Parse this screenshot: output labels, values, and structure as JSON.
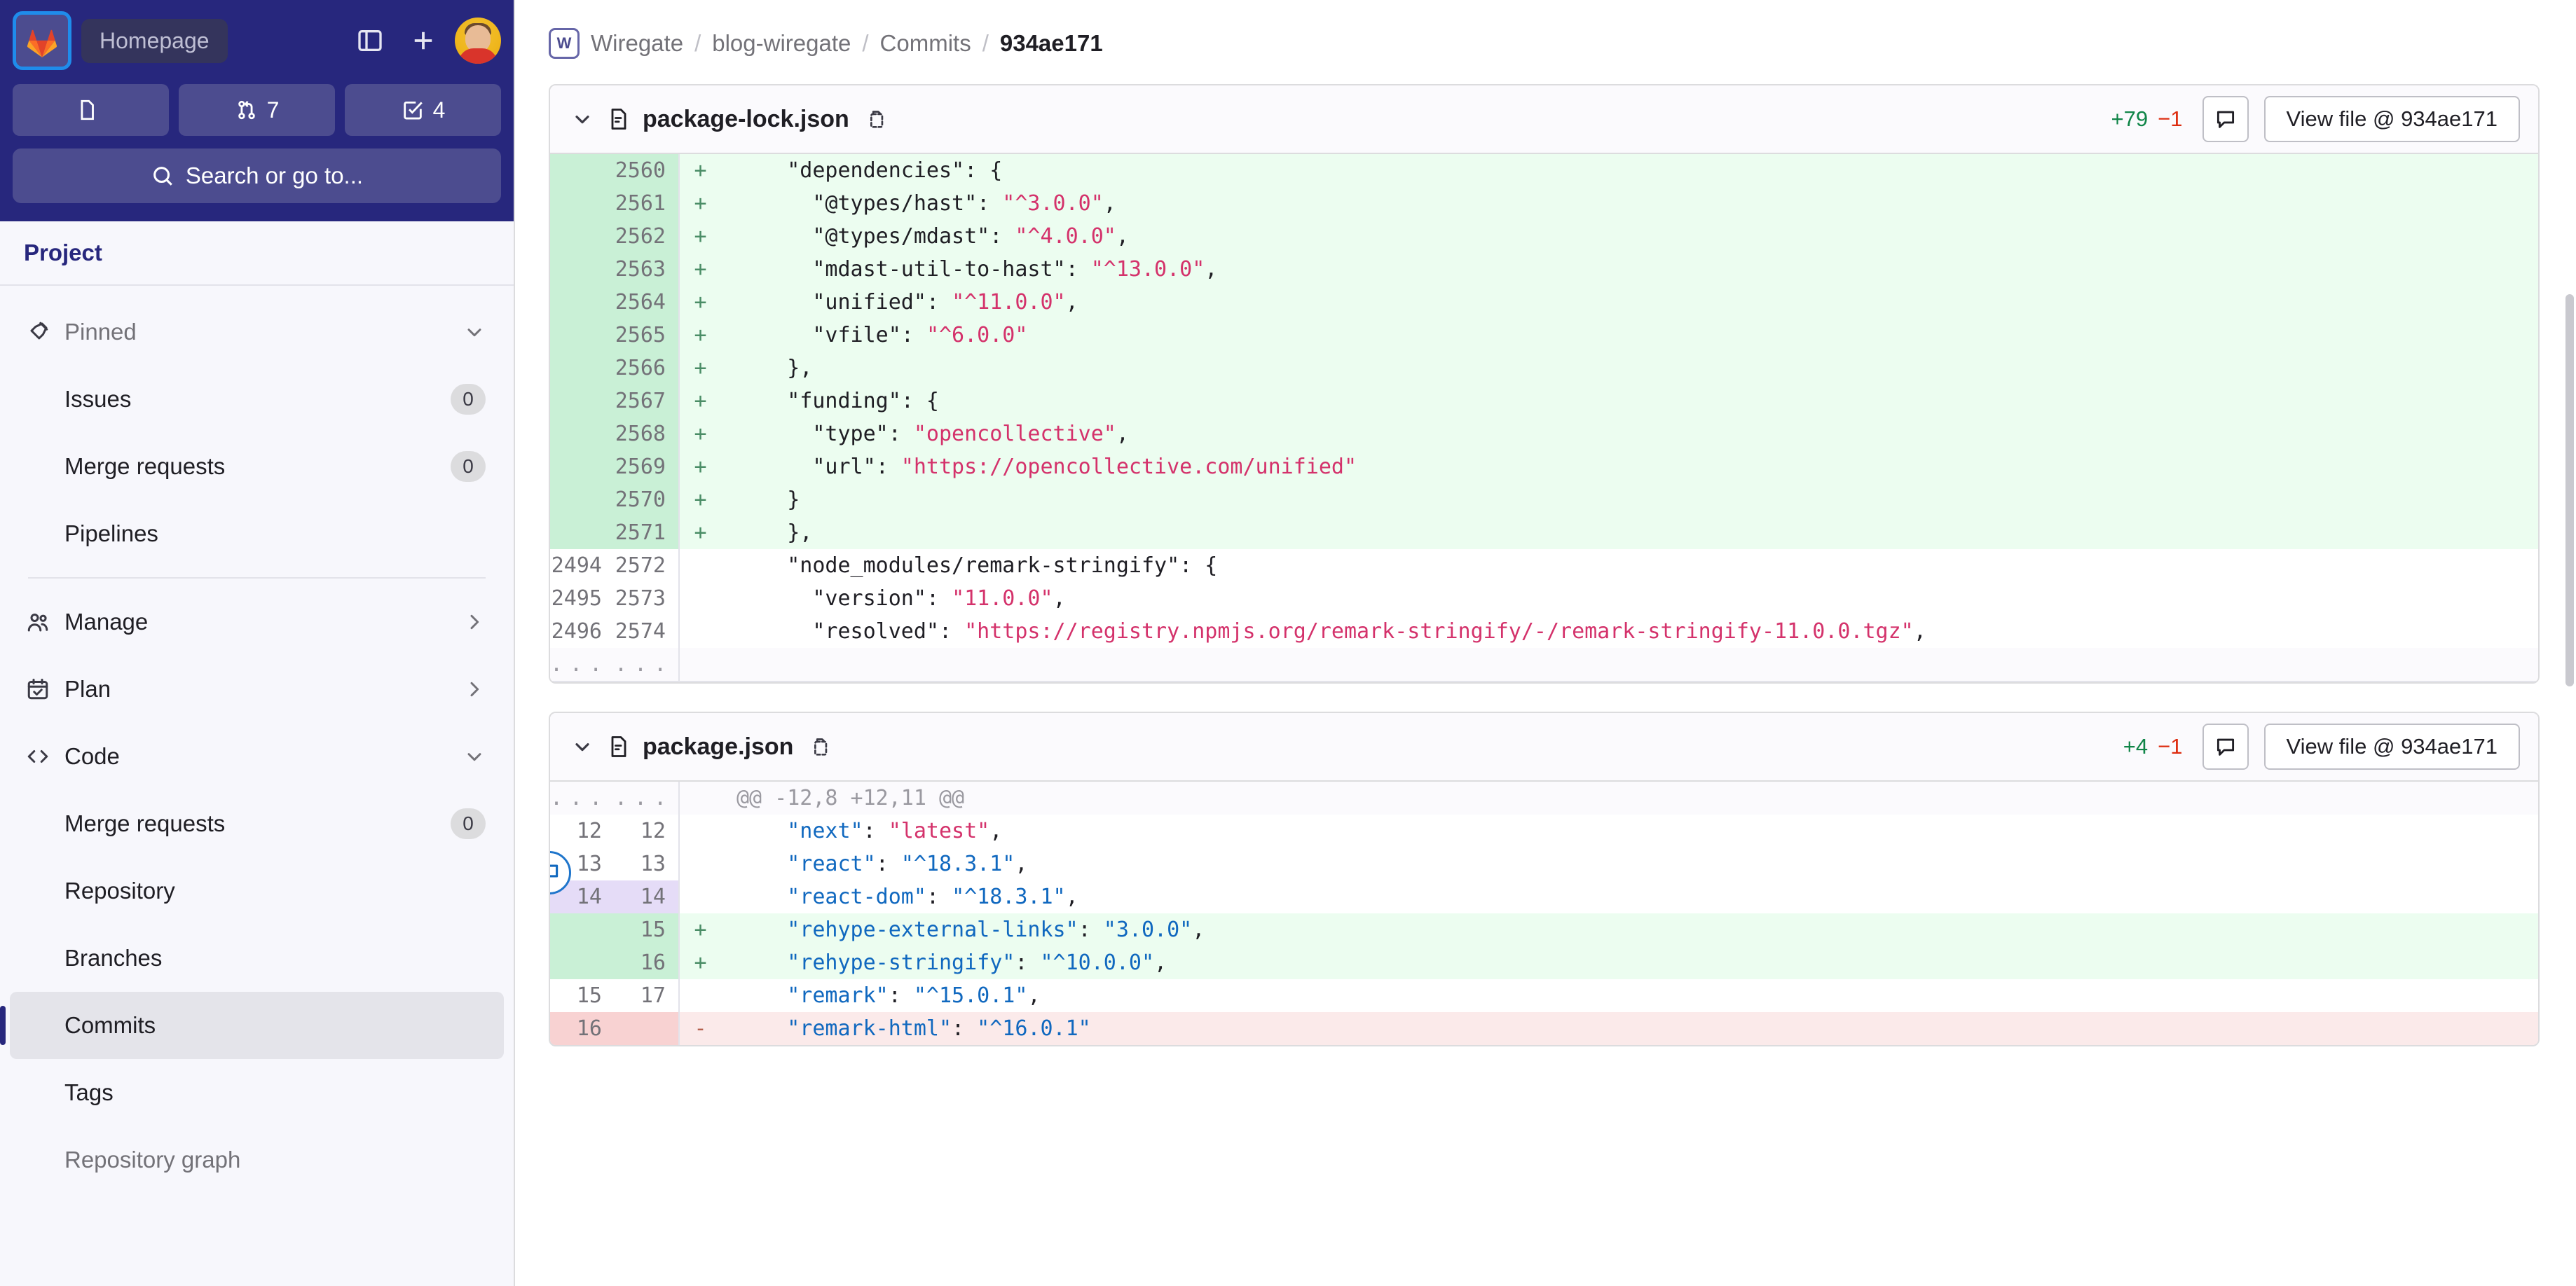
{
  "sidebar": {
    "homepage_label": "Homepage",
    "toggle_icon": "sidebar-toggle-icon",
    "new_icon": "plus-icon",
    "avatar_icon": "user-avatar",
    "chips": [
      {
        "icon": "issues-icon",
        "count": ""
      },
      {
        "icon": "merge-request-icon",
        "count": "7"
      },
      {
        "icon": "todo-check-icon",
        "count": "4"
      }
    ],
    "search_placeholder": "Search or go to...",
    "search_icon": "search-icon",
    "project_title": "Project",
    "nav": [
      {
        "label": "Pinned",
        "icon": "pin-icon",
        "chevron": "chevron-down-icon",
        "muted": true,
        "indent": false,
        "count": null
      },
      {
        "label": "Issues",
        "icon": null,
        "chevron": null,
        "muted": false,
        "indent": true,
        "count": "0"
      },
      {
        "label": "Merge requests",
        "icon": null,
        "chevron": null,
        "muted": false,
        "indent": true,
        "count": "0"
      },
      {
        "label": "Pipelines",
        "icon": null,
        "chevron": null,
        "muted": false,
        "indent": true,
        "count": null
      },
      {
        "separator": true
      },
      {
        "label": "Manage",
        "icon": "people-icon",
        "chevron": "chevron-right-icon",
        "muted": false,
        "indent": false,
        "count": null
      },
      {
        "label": "Plan",
        "icon": "calendar-icon",
        "chevron": "chevron-right-icon",
        "muted": false,
        "indent": false,
        "count": null
      },
      {
        "label": "Code",
        "icon": "code-icon",
        "chevron": "chevron-down-icon",
        "muted": false,
        "indent": false,
        "count": null
      },
      {
        "label": "Merge requests",
        "icon": null,
        "chevron": null,
        "muted": false,
        "indent": true,
        "count": "0"
      },
      {
        "label": "Repository",
        "icon": null,
        "chevron": null,
        "muted": false,
        "indent": true,
        "count": null
      },
      {
        "label": "Branches",
        "icon": null,
        "chevron": null,
        "muted": false,
        "indent": true,
        "count": null
      },
      {
        "label": "Commits",
        "icon": null,
        "chevron": null,
        "muted": false,
        "indent": true,
        "count": null,
        "active": true
      },
      {
        "label": "Tags",
        "icon": null,
        "chevron": null,
        "muted": false,
        "indent": true,
        "count": null
      },
      {
        "label": "Repository graph",
        "icon": null,
        "chevron": null,
        "muted": true,
        "indent": true,
        "count": null
      }
    ]
  },
  "breadcrumb": {
    "avatar_letter": "W",
    "group": "Wiregate",
    "project": "blog-wiregate",
    "section": "Commits",
    "current": "934ae171",
    "separator": "/"
  },
  "files": [
    {
      "name": "package-lock.json",
      "chevron_icon": "chevron-down-icon",
      "file_icon": "document-icon",
      "copy_icon": "copy-path-icon",
      "additions": "+79",
      "deletions": "−1",
      "comment_icon": "comment-icon",
      "view_file_label": "View file @ 934ae171",
      "hunk_header": null,
      "lines": [
        {
          "type": "add",
          "old": "",
          "new": "2560",
          "sign": "+",
          "tokens": [
            {
              "t": "    \"dependencies\"",
              "c": "key"
            },
            {
              "t": ": {",
              "c": "plain"
            }
          ]
        },
        {
          "type": "add",
          "old": "",
          "new": "2561",
          "sign": "+",
          "tokens": [
            {
              "t": "      \"@types/hast\"",
              "c": "key"
            },
            {
              "t": ": ",
              "c": "plain"
            },
            {
              "t": "\"^3.0.0\"",
              "c": "str"
            },
            {
              "t": ",",
              "c": "plain"
            }
          ]
        },
        {
          "type": "add",
          "old": "",
          "new": "2562",
          "sign": "+",
          "tokens": [
            {
              "t": "      \"@types/mdast\"",
              "c": "key"
            },
            {
              "t": ": ",
              "c": "plain"
            },
            {
              "t": "\"^4.0.0\"",
              "c": "str"
            },
            {
              "t": ",",
              "c": "plain"
            }
          ]
        },
        {
          "type": "add",
          "old": "",
          "new": "2563",
          "sign": "+",
          "tokens": [
            {
              "t": "      \"mdast-util-to-hast\"",
              "c": "key"
            },
            {
              "t": ": ",
              "c": "plain"
            },
            {
              "t": "\"^13.0.0\"",
              "c": "str"
            },
            {
              "t": ",",
              "c": "plain"
            }
          ]
        },
        {
          "type": "add",
          "old": "",
          "new": "2564",
          "sign": "+",
          "tokens": [
            {
              "t": "      \"unified\"",
              "c": "key"
            },
            {
              "t": ": ",
              "c": "plain"
            },
            {
              "t": "\"^11.0.0\"",
              "c": "str"
            },
            {
              "t": ",",
              "c": "plain"
            }
          ]
        },
        {
          "type": "add",
          "old": "",
          "new": "2565",
          "sign": "+",
          "tokens": [
            {
              "t": "      \"vfile\"",
              "c": "key"
            },
            {
              "t": ": ",
              "c": "plain"
            },
            {
              "t": "\"^6.0.0\"",
              "c": "str"
            }
          ]
        },
        {
          "type": "add",
          "old": "",
          "new": "2566",
          "sign": "+",
          "tokens": [
            {
              "t": "    },",
              "c": "plain"
            }
          ]
        },
        {
          "type": "add",
          "old": "",
          "new": "2567",
          "sign": "+",
          "tokens": [
            {
              "t": "    \"funding\"",
              "c": "key"
            },
            {
              "t": ": {",
              "c": "plain"
            }
          ]
        },
        {
          "type": "add",
          "old": "",
          "new": "2568",
          "sign": "+",
          "tokens": [
            {
              "t": "      \"type\"",
              "c": "key"
            },
            {
              "t": ": ",
              "c": "plain"
            },
            {
              "t": "\"opencollective\"",
              "c": "str"
            },
            {
              "t": ",",
              "c": "plain"
            }
          ]
        },
        {
          "type": "add",
          "old": "",
          "new": "2569",
          "sign": "+",
          "tokens": [
            {
              "t": "      \"url\"",
              "c": "key"
            },
            {
              "t": ": ",
              "c": "plain"
            },
            {
              "t": "\"https://opencollective.com/unified\"",
              "c": "str"
            }
          ]
        },
        {
          "type": "add",
          "old": "",
          "new": "2570",
          "sign": "+",
          "tokens": [
            {
              "t": "    }",
              "c": "plain"
            }
          ]
        },
        {
          "type": "add",
          "old": "",
          "new": "2571",
          "sign": "+",
          "tokens": [
            {
              "t": "    },",
              "c": "plain"
            }
          ]
        },
        {
          "type": "ctx",
          "old": "2494",
          "new": "2572",
          "sign": "",
          "tokens": [
            {
              "t": "    \"node_modules/remark-stringify\"",
              "c": "key"
            },
            {
              "t": ": {",
              "c": "plain"
            }
          ]
        },
        {
          "type": "ctx",
          "old": "2495",
          "new": "2573",
          "sign": "",
          "tokens": [
            {
              "t": "      \"version\"",
              "c": "key"
            },
            {
              "t": ": ",
              "c": "plain"
            },
            {
              "t": "\"11.0.0\"",
              "c": "str"
            },
            {
              "t": ",",
              "c": "plain"
            }
          ]
        },
        {
          "type": "ctx",
          "old": "2496",
          "new": "2574",
          "sign": "",
          "tokens": [
            {
              "t": "      \"resolved\"",
              "c": "key"
            },
            {
              "t": ": ",
              "c": "plain"
            },
            {
              "t": "\"https://registry.npmjs.org/remark-stringify/-/remark-stringify-11.0.0.tgz\"",
              "c": "str"
            },
            {
              "t": ",",
              "c": "plain"
            }
          ]
        },
        {
          "type": "meta",
          "old": "...",
          "new": "...",
          "sign": "",
          "tokens": []
        }
      ]
    },
    {
      "name": "package.json",
      "chevron_icon": "chevron-down-icon",
      "file_icon": "document-icon",
      "copy_icon": "copy-path-icon",
      "additions": "+4",
      "deletions": "−1",
      "comment_icon": "comment-icon",
      "view_file_label": "View file @ 934ae171",
      "hunk_header": "@@ -12,8 +12,11 @@",
      "lines": [
        {
          "type": "meta",
          "old": "...",
          "new": "...",
          "sign": "",
          "hunk": true
        },
        {
          "type": "ctx",
          "old": "12",
          "new": "12",
          "sign": "",
          "tokens": [
            {
              "t": "    \"next\"",
              "c": "bkey"
            },
            {
              "t": ": ",
              "c": "plain"
            },
            {
              "t": "\"latest\"",
              "c": "str"
            },
            {
              "t": ",",
              "c": "plain"
            }
          ]
        },
        {
          "type": "ctx",
          "old": "13",
          "new": "13",
          "sign": "",
          "tokens": [
            {
              "t": "    \"react\"",
              "c": "bkey"
            },
            {
              "t": ": ",
              "c": "plain"
            },
            {
              "t": "\"^18.3.1\"",
              "c": "bstr"
            },
            {
              "t": ",",
              "c": "plain"
            }
          ]
        },
        {
          "type": "hl",
          "old": "14",
          "new": "14",
          "sign": "",
          "has_comment": true,
          "tokens": [
            {
              "t": "    \"react-dom\"",
              "c": "bkey"
            },
            {
              "t": ": ",
              "c": "plain"
            },
            {
              "t": "\"^18.3.1\"",
              "c": "bstr"
            },
            {
              "t": ",",
              "c": "plain"
            }
          ]
        },
        {
          "type": "add",
          "old": "",
          "new": "15",
          "sign": "+",
          "tokens": [
            {
              "t": "    \"rehype-external-links\"",
              "c": "bkey"
            },
            {
              "t": ": ",
              "c": "plain"
            },
            {
              "t": "\"3.0.0\"",
              "c": "bstr"
            },
            {
              "t": ",",
              "c": "plain"
            }
          ]
        },
        {
          "type": "add",
          "old": "",
          "new": "16",
          "sign": "+",
          "tokens": [
            {
              "t": "    \"rehype-stringify\"",
              "c": "bkey"
            },
            {
              "t": ": ",
              "c": "plain"
            },
            {
              "t": "\"^10.0.0\"",
              "c": "bstr"
            },
            {
              "t": ",",
              "c": "plain"
            }
          ]
        },
        {
          "type": "ctx",
          "old": "15",
          "new": "17",
          "sign": "",
          "tokens": [
            {
              "t": "    \"remark\"",
              "c": "bkey"
            },
            {
              "t": ": ",
              "c": "plain"
            },
            {
              "t": "\"^15.0.1\"",
              "c": "bstr"
            },
            {
              "t": ",",
              "c": "plain"
            }
          ]
        },
        {
          "type": "del",
          "old": "16",
          "new": "",
          "sign": "-",
          "tokens": [
            {
              "t": "    \"remark-html\"",
              "c": "bkey"
            },
            {
              "t": ": ",
              "c": "plain"
            },
            {
              "t": "\"^16.0.1\"",
              "c": "bstr"
            }
          ]
        }
      ]
    }
  ],
  "colors": {
    "brand_navy": "#27277d",
    "add_green": "#108548",
    "del_red": "#dd2b0e",
    "link_blue": "#1068bf",
    "string_pink": "#d4326b"
  }
}
